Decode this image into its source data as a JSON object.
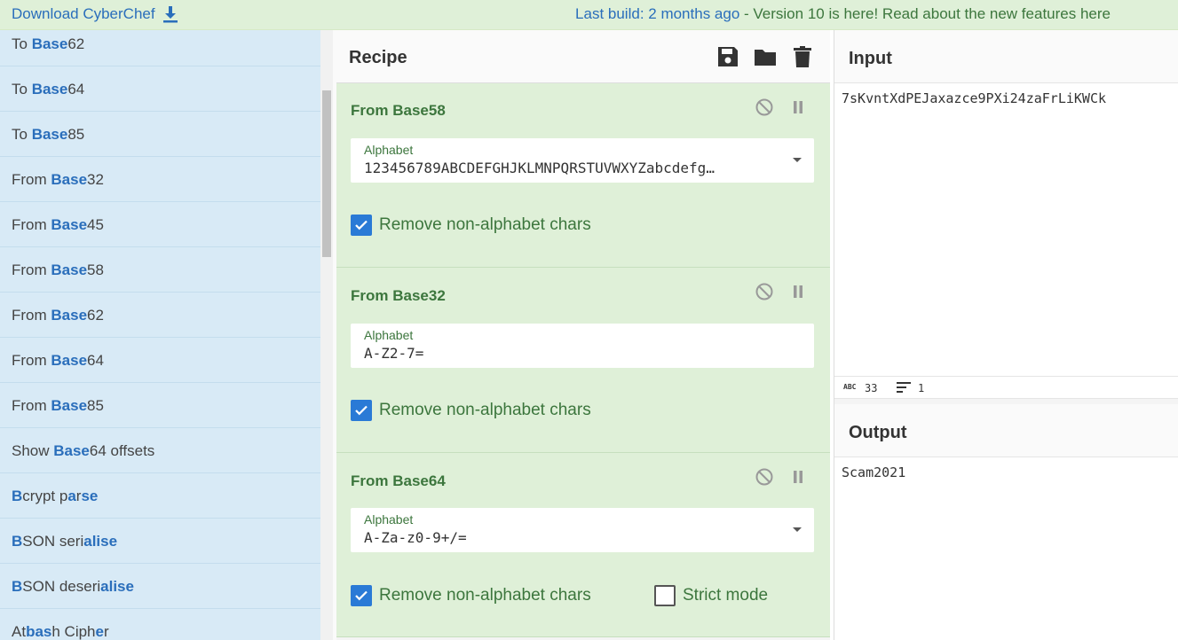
{
  "banner": {
    "download_label": "Download CyberChef",
    "last_build": "Last build: 2 months ago",
    "version_note": " - Version 10 is here! Read about the new features here"
  },
  "operations": [
    {
      "pre": "To ",
      "bold": "Base",
      "post": "62"
    },
    {
      "pre": "To ",
      "bold": "Base",
      "post": "64"
    },
    {
      "pre": "To ",
      "bold": "Base",
      "post": "85"
    },
    {
      "pre": "From ",
      "bold": "Base",
      "post": "32"
    },
    {
      "pre": "From ",
      "bold": "Base",
      "post": "45"
    },
    {
      "pre": "From ",
      "bold": "Base",
      "post": "58"
    },
    {
      "pre": "From ",
      "bold": "Base",
      "post": "62"
    },
    {
      "pre": "From ",
      "bold": "Base",
      "post": "64"
    },
    {
      "pre": "From ",
      "bold": "Base",
      "post": "85"
    },
    {
      "pre": "Show ",
      "bold": "Base",
      "post": "64 offsets"
    },
    {
      "html": "<b>B</b>crypt p<b>a</b>r<b>se</b>"
    },
    {
      "html": "<b>B</b>SON seri<b>alise</b>"
    },
    {
      "html": "<b>B</b>SON deseri<b>alise</b>"
    },
    {
      "html": "At<b>bas</b>h Ciph<b>e</b>r"
    }
  ],
  "recipe": {
    "title": "Recipe",
    "ops": [
      {
        "name": "From Base58",
        "field_label": "Alphabet",
        "field_value": "123456789ABCDEFGHJKLMNPQRSTUVWXYZabcdefg…",
        "has_dropdown": true,
        "check_label": "Remove non-alphabet chars",
        "checked": true
      },
      {
        "name": "From Base32",
        "field_label": "Alphabet",
        "field_value": "A-Z2-7=",
        "has_dropdown": false,
        "check_label": "Remove non-alphabet chars",
        "checked": true
      },
      {
        "name": "From Base64",
        "field_label": "Alphabet",
        "field_value": "A-Za-z0-9+/=",
        "has_dropdown": true,
        "check_label": "Remove non-alphabet chars",
        "checked": true,
        "strict_label": "Strict mode",
        "strict_checked": false
      }
    ]
  },
  "input": {
    "title": "Input",
    "text": "7sKvntXdPEJaxazce9PXi24zaFrLiKWCk",
    "char_count": "33",
    "line_count": "1",
    "abc_label": "ABC"
  },
  "output": {
    "title": "Output",
    "text": "Scam2021"
  },
  "colors": {
    "accent": "#2a7ad6",
    "op_green": "#dff0d8",
    "sidebar_blue": "#d8eaf6"
  }
}
